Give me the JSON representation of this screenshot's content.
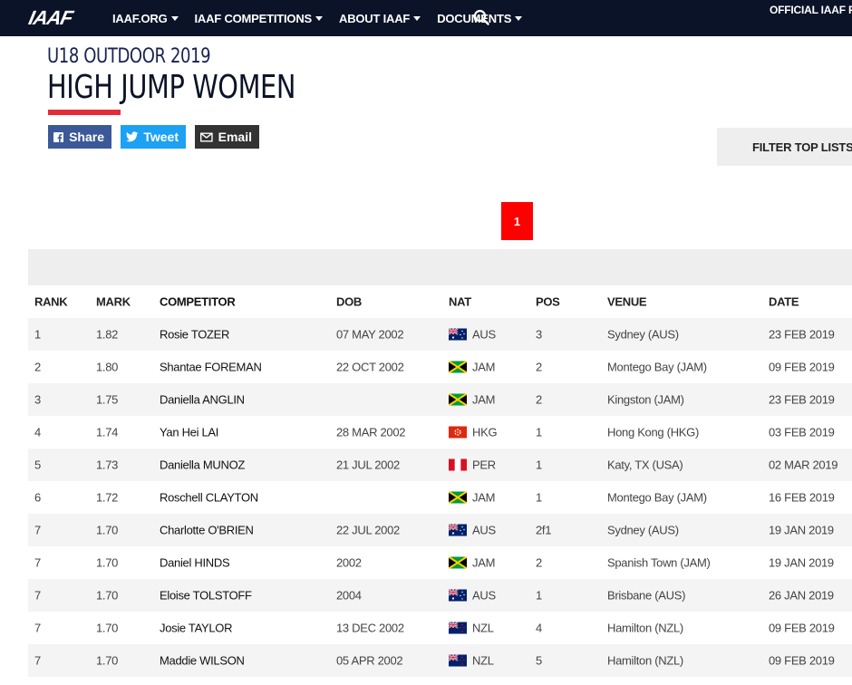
{
  "nav": {
    "logo": "IAAF",
    "items": [
      {
        "label": "IAAF.ORG"
      },
      {
        "label": "IAAF COMPETITIONS"
      },
      {
        "label": "ABOUT IAAF"
      },
      {
        "label": "DOCUMENTS"
      }
    ],
    "partners": "OFFICIAL IAAF PARTN"
  },
  "header": {
    "subtitle": "U18 OUTDOOR 2019",
    "title": "HIGH JUMP WOMEN"
  },
  "share": {
    "share_label": "Share",
    "tweet_label": "Tweet",
    "email_label": "Email"
  },
  "filter_label": "FILTER TOP LISTS",
  "pagination": {
    "current": "1"
  },
  "table": {
    "columns": {
      "rank": "RANK",
      "mark": "MARK",
      "competitor": "COMPETITOR",
      "dob": "DOB",
      "nat": "NAT",
      "pos": "POS",
      "venue": "VENUE",
      "date": "DATE"
    },
    "rows": [
      {
        "rank": "1",
        "mark": "1.82",
        "competitor": "Rosie TOZER",
        "dob": "07 MAY 2002",
        "nat": "AUS",
        "flag": "aus",
        "pos": "3",
        "venue": "Sydney (AUS)",
        "date": "23 FEB 2019"
      },
      {
        "rank": "2",
        "mark": "1.80",
        "competitor": "Shantae FOREMAN",
        "dob": "22 OCT 2002",
        "nat": "JAM",
        "flag": "jam",
        "pos": "2",
        "venue": "Montego Bay (JAM)",
        "date": "09 FEB 2019"
      },
      {
        "rank": "3",
        "mark": "1.75",
        "competitor": "Daniella ANGLIN",
        "dob": "",
        "nat": "JAM",
        "flag": "jam",
        "pos": "2",
        "venue": "Kingston (JAM)",
        "date": "23 FEB 2019"
      },
      {
        "rank": "4",
        "mark": "1.74",
        "competitor": "Yan Hei LAI",
        "dob": "28 MAR 2002",
        "nat": "HKG",
        "flag": "hkg",
        "pos": "1",
        "venue": "Hong Kong (HKG)",
        "date": "03 FEB 2019"
      },
      {
        "rank": "5",
        "mark": "1.73",
        "competitor": "Daniella MUNOZ",
        "dob": "21 JUL 2002",
        "nat": "PER",
        "flag": "per",
        "pos": "1",
        "venue": "Katy, TX (USA)",
        "date": "02 MAR 2019"
      },
      {
        "rank": "6",
        "mark": "1.72",
        "competitor": "Roschell CLAYTON",
        "dob": "",
        "nat": "JAM",
        "flag": "jam",
        "pos": "1",
        "venue": "Montego Bay (JAM)",
        "date": "16 FEB 2019"
      },
      {
        "rank": "7",
        "mark": "1.70",
        "competitor": "Charlotte O'BRIEN",
        "dob": "22 JUL 2002",
        "nat": "AUS",
        "flag": "aus",
        "pos": "2f1",
        "venue": "Sydney (AUS)",
        "date": "19 JAN 2019"
      },
      {
        "rank": "7",
        "mark": "1.70",
        "competitor": "Daniel HINDS",
        "dob": "2002",
        "nat": "JAM",
        "flag": "jam",
        "pos": "2",
        "venue": "Spanish Town (JAM)",
        "date": "19 JAN 2019"
      },
      {
        "rank": "7",
        "mark": "1.70",
        "competitor": "Eloise TOLSTOFF",
        "dob": "2004",
        "nat": "AUS",
        "flag": "aus",
        "pos": "1",
        "venue": "Brisbane (AUS)",
        "date": "26 JAN 2019"
      },
      {
        "rank": "7",
        "mark": "1.70",
        "competitor": "Josie TAYLOR",
        "dob": "13 DEC 2002",
        "nat": "NZL",
        "flag": "nzl",
        "pos": "4",
        "venue": "Hamilton (NZL)",
        "date": "09 FEB 2019"
      },
      {
        "rank": "7",
        "mark": "1.70",
        "competitor": "Maddie WILSON",
        "dob": "05 APR 2002",
        "nat": "NZL",
        "flag": "nzl",
        "pos": "5",
        "venue": "Hamilton (NZL)",
        "date": "09 FEB 2019"
      }
    ]
  }
}
